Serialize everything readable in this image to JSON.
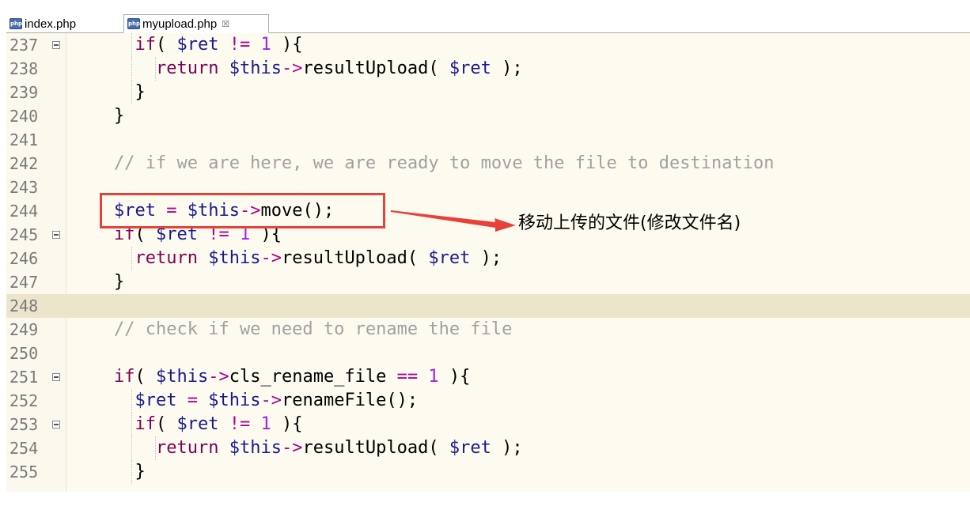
{
  "tabs": [
    {
      "label": "index.php",
      "icon": "php-file-icon",
      "active": false
    },
    {
      "label": "myupload.php",
      "icon": "php-file-icon",
      "active": true,
      "close": "☒"
    }
  ],
  "php_icon_text": "php",
  "lines": [
    {
      "num": "237",
      "fold": true,
      "indent": 1,
      "text": "  if( $ret != 1 ){"
    },
    {
      "num": "238",
      "fold": false,
      "indent": 2,
      "text": "    return $this->resultUpload( $ret );"
    },
    {
      "num": "239",
      "fold": false,
      "indent": 1,
      "text": "  }"
    },
    {
      "num": "240",
      "fold": false,
      "indent": 0,
      "text": "}"
    },
    {
      "num": "241",
      "fold": false,
      "indent": 0,
      "text": ""
    },
    {
      "num": "242",
      "fold": false,
      "indent": 0,
      "text": "// if we are here, we are ready to move the file to destination",
      "comment": true
    },
    {
      "num": "243",
      "fold": false,
      "indent": 0,
      "text": ""
    },
    {
      "num": "244",
      "fold": false,
      "indent": 0,
      "text": "$ret = $this->move();"
    },
    {
      "num": "245",
      "fold": true,
      "indent": 0,
      "text": "if( $ret != 1 ){"
    },
    {
      "num": "246",
      "fold": false,
      "indent": 1,
      "text": "  return $this->resultUpload( $ret );"
    },
    {
      "num": "247",
      "fold": false,
      "indent": 0,
      "text": "}"
    },
    {
      "num": "248",
      "fold": false,
      "indent": 0,
      "text": "",
      "highlight": true
    },
    {
      "num": "249",
      "fold": false,
      "indent": 0,
      "text": "// check if we need to rename the file",
      "comment": true
    },
    {
      "num": "250",
      "fold": false,
      "indent": 0,
      "text": ""
    },
    {
      "num": "251",
      "fold": true,
      "indent": 0,
      "text": "if( $this->cls_rename_file == 1 ){"
    },
    {
      "num": "252",
      "fold": false,
      "indent": 1,
      "text": "  $ret = $this->renameFile();"
    },
    {
      "num": "253",
      "fold": true,
      "indent": 1,
      "text": "  if( $ret != 1 ){"
    },
    {
      "num": "254",
      "fold": false,
      "indent": 2,
      "text": "    return $this->resultUpload( $ret );"
    },
    {
      "num": "255",
      "fold": false,
      "indent": 1,
      "text": "  }"
    }
  ],
  "annotation": "移动上传的文件(修改文件名)",
  "colors": {
    "keyword": "#7f0055",
    "variable": "#1a1a8c",
    "number": "#a020f0",
    "operator": "#b0008b",
    "comment": "#a0a0a0",
    "annotation_box": "#e8413a"
  }
}
